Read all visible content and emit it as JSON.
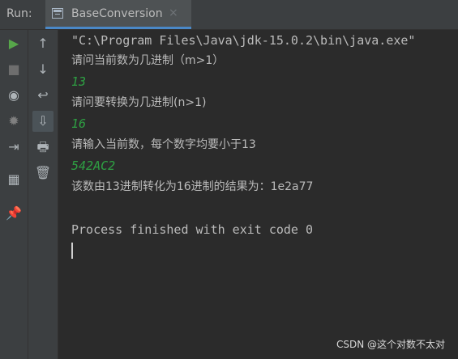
{
  "header": {
    "run_label": "Run:",
    "tab_title": "BaseConversion",
    "close_icon": "×"
  },
  "toolbar": {
    "left": {
      "run_icon": "▶",
      "stop_icon": "■",
      "camera_icon": "◉",
      "debug_icon": "✹",
      "login_icon": "⇥",
      "layout_icon": "▦",
      "pin_icon": "📌"
    },
    "right": {
      "up_icon": "↑",
      "down_icon": "↓",
      "wrap_icon": "↩",
      "scroll_end_icon": "⇩",
      "print_icon": "🖶",
      "trash_icon": "🗑"
    }
  },
  "console": {
    "lines": [
      {
        "text": "\"C:\\Program Files\\Java\\jdk-15.0.2\\bin\\java.exe\"",
        "type": "normal"
      },
      {
        "text": "请问当前数为几进制（m>1）",
        "type": "normal"
      },
      {
        "text": "13",
        "type": "input"
      },
      {
        "text": "请问要转换为几进制(n>1)",
        "type": "normal"
      },
      {
        "text": "16",
        "type": "input"
      },
      {
        "text": "请输入当前数，每个数字均要小于13",
        "type": "normal"
      },
      {
        "text": "542AC2",
        "type": "input"
      },
      {
        "text": "该数由13进制转化为16进制的结果为：1e2a77",
        "type": "normal"
      },
      {
        "text": "Process finished with exit code 0",
        "type": "normal"
      }
    ]
  },
  "watermark": "CSDN @这个对数不太对",
  "colors": {
    "background": "#2b2b2b",
    "panel": "#3c3f41",
    "text": "#bbbbbb",
    "input": "#2ea043",
    "accent": "#4a88c7",
    "run_green": "#57a64a"
  }
}
